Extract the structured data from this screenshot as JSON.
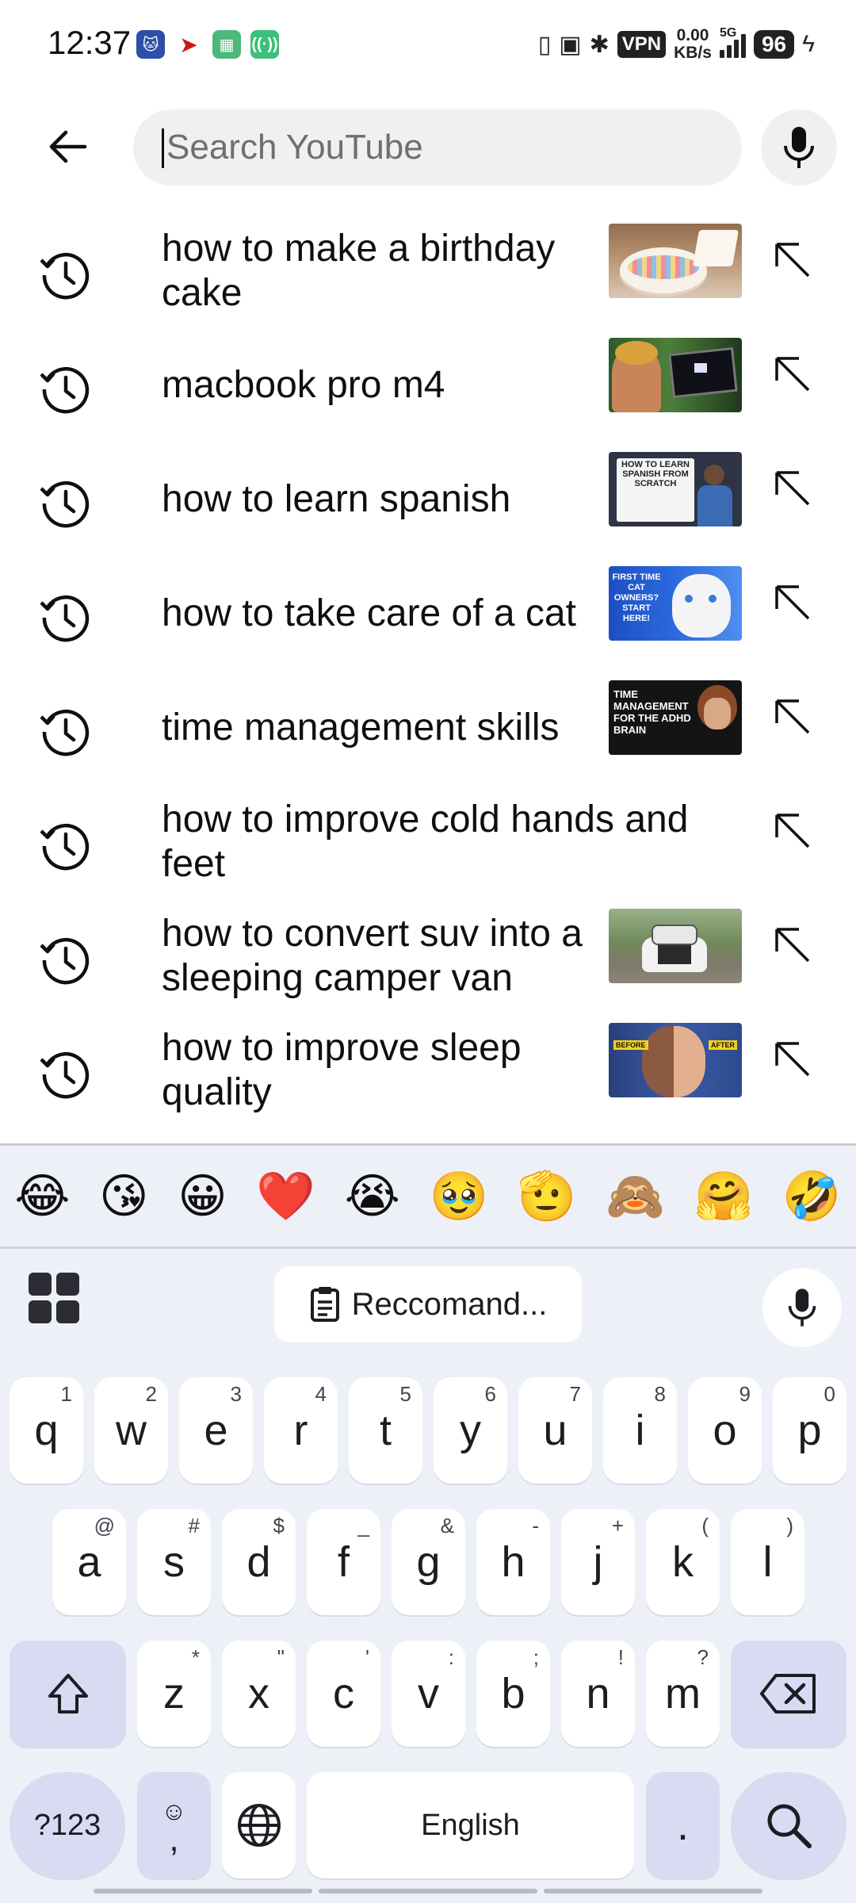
{
  "status": {
    "time": "12:37",
    "net_speed_value": "0.00",
    "net_speed_unit": "KB/s",
    "network": "5G",
    "vpn": "VPN",
    "battery": "96"
  },
  "search": {
    "placeholder": "Search YouTube"
  },
  "suggestions": [
    {
      "text": "how to make a birthday cake",
      "thumb": "cake"
    },
    {
      "text": "macbook pro m4",
      "thumb": "laptop"
    },
    {
      "text": "how to learn spanish",
      "thumb": "spanish",
      "thumb_text": "HOW TO LEARN SPANISH FROM SCRATCH"
    },
    {
      "text": "how to take care of a cat",
      "thumb": "cat",
      "thumb_text": "FIRST TIME CAT OWNERS? START HERE!"
    },
    {
      "text": "time management skills",
      "thumb": "adhd",
      "thumb_text": "TIME MANAGEMENT FOR THE ADHD BRAIN"
    },
    {
      "text": "how to improve cold hands and feet",
      "thumb": ""
    },
    {
      "text": "how to convert suv into a sleeping camper van",
      "thumb": "suv"
    },
    {
      "text": "how to improve sleep quality",
      "thumb": "sleep",
      "thumb_text": "BEFORE AFTER"
    }
  ],
  "keyboard": {
    "emojis": [
      "😂",
      "😘",
      "😀",
      "❤️",
      "😭",
      "🥹",
      "🫡",
      "🙈",
      "🤗",
      "🤣"
    ],
    "clipboard_chip": "Reccomand...",
    "row1": [
      [
        "q",
        "1"
      ],
      [
        "w",
        "2"
      ],
      [
        "e",
        "3"
      ],
      [
        "r",
        "4"
      ],
      [
        "t",
        "5"
      ],
      [
        "y",
        "6"
      ],
      [
        "u",
        "7"
      ],
      [
        "i",
        "8"
      ],
      [
        "o",
        "9"
      ],
      [
        "p",
        "0"
      ]
    ],
    "row2": [
      [
        "a",
        "@"
      ],
      [
        "s",
        "#"
      ],
      [
        "d",
        "$"
      ],
      [
        "f",
        "_"
      ],
      [
        "g",
        "&"
      ],
      [
        "h",
        "-"
      ],
      [
        "j",
        "+"
      ],
      [
        "k",
        "("
      ],
      [
        "l",
        ")"
      ]
    ],
    "row3": [
      [
        "z",
        "*"
      ],
      [
        "x",
        "\""
      ],
      [
        "c",
        "'"
      ],
      [
        "v",
        ":"
      ],
      [
        "b",
        ";"
      ],
      [
        "n",
        "!"
      ],
      [
        "m",
        "?"
      ]
    ],
    "symbols_key": "?123",
    "comma_key": ",",
    "space_label": "English",
    "period_key": "."
  }
}
